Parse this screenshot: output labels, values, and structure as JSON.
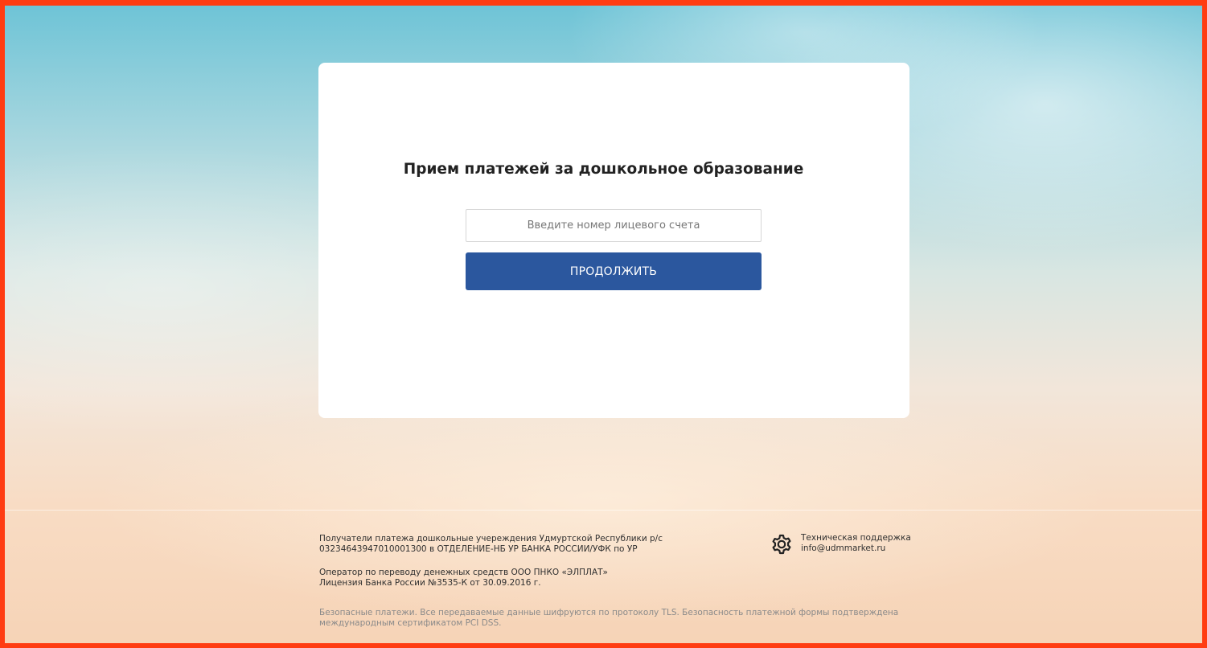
{
  "card": {
    "title": "Прием платежей за дошкольное образование",
    "account_input_placeholder": "Введите номер лицевого счета",
    "account_input_value": "",
    "continue_label": "ПРОДОЛЖИТЬ"
  },
  "footer": {
    "recipient_line1": "Получатели платежа дошкольные учереждения Удмуртской Республики р/с",
    "recipient_line2": "03234643947010001300 в ОТДЕЛЕНИЕ-НБ УР БАНКА РОССИИ/УФК по УР",
    "operator_line1": "Оператор по переводу денежных средств ООО ПНКО «ЭЛПЛАТ»",
    "operator_line2": "Лицензия Банка России №3535-К от 30.09.2016 г.",
    "security_line1": "Безопасные платежи. Все передаваемые данные шифруются по протоколу TLS. Безопасность платежной формы подтверждена",
    "security_line2": "международным сертификатом PCI DSS.",
    "support_title": "Техническая поддержка",
    "support_email": "info@udmmarket.ru",
    "support_icon": "gear-icon"
  },
  "colors": {
    "button": "#2b579e",
    "frame": "#ff3c12"
  }
}
